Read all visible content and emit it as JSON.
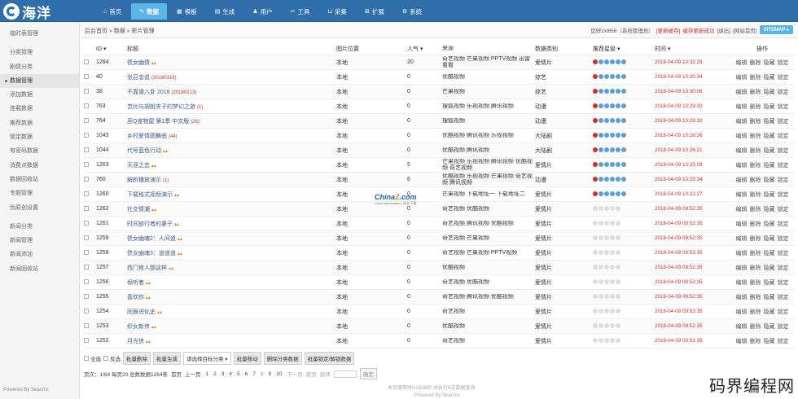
{
  "app": {
    "logo_text": "海洋"
  },
  "nav": [
    {
      "label": "首页",
      "icon": "⌂"
    },
    {
      "label": "数据",
      "icon": "✎",
      "active": true
    },
    {
      "label": "模板",
      "icon": "▦"
    },
    {
      "label": "生成",
      "icon": "▤"
    },
    {
      "label": "用户",
      "icon": "♟"
    },
    {
      "label": "工具",
      "icon": "✂"
    },
    {
      "label": "采集",
      "icon": "⊔"
    },
    {
      "label": "扩展",
      "icon": "⊞"
    },
    {
      "label": "系统",
      "icon": "⚙"
    }
  ],
  "sidebar": {
    "items": [
      {
        "label": "临时表管理"
      },
      {
        "sep": true
      },
      {
        "label": "分类管理"
      },
      {
        "label": "剧情分类"
      },
      {
        "label": "数据管理",
        "active": true
      },
      {
        "label": "添加数据"
      },
      {
        "label": "连载数据"
      },
      {
        "label": "推荐数据"
      },
      {
        "label": "锁定数据"
      },
      {
        "label": "有密码数据"
      },
      {
        "label": "消费点数据"
      },
      {
        "label": "数据回收站"
      },
      {
        "label": "专题管理"
      },
      {
        "label": "伪原创设置"
      },
      {
        "sep": true
      },
      {
        "label": "新闻分类"
      },
      {
        "label": "新闻管理"
      },
      {
        "label": "新闻添加"
      },
      {
        "label": "新闻回收站"
      }
    ],
    "footer": "Powered By Seacms"
  },
  "breadcrumb": "后台首页 » 数据 » 影片管理",
  "userbar": {
    "greeting": "您好zxt856（系统管理员）",
    "update_cache": "[更新缓存]",
    "cache_msg": "缓存更新成功",
    "logout": "[退出]",
    "home": "[网站首页]",
    "sitemap": "SITEMAP ▸"
  },
  "table": {
    "headers": {
      "id": "ID ▾",
      "title": "标题",
      "pic": "图片位置",
      "hot": "人气 ▾",
      "src": "来源",
      "type": "数据类别",
      "star": "推荐星级 ▾",
      "time": "时间 ▾",
      "ops": "操作"
    },
    "rows": [
      {
        "id": "1264",
        "title": "债女幽情",
        "tag": "",
        "hot_icon": true,
        "pic": "本地",
        "hot": "20",
        "src": "奇艺视频 芒果视频 PPTV视频 迅雷看看",
        "type": "爱情片",
        "stars": "rated",
        "time": "2018-04-09 10:32:25"
      },
      {
        "id": "40",
        "title": "张召忠说",
        "tag": "(20180316)",
        "hot_icon": false,
        "pic": "本地",
        "hot": "0",
        "src": "优酷视频",
        "type": "综艺",
        "stars": "rated",
        "time": "2018-04-09 10:30:34"
      },
      {
        "id": "38",
        "title": "不靠谱八卦 2018",
        "tag": "(20180213)",
        "hot_icon": false,
        "pic": "本地",
        "hot": "0",
        "src": "芒果视频",
        "type": "综艺",
        "stars": "rated",
        "time": "2018-04-09 10:30:06"
      },
      {
        "id": "763",
        "title": "岂比与胡桃夹子的梦幻之旅",
        "tag": "(1)",
        "hot_icon": false,
        "pic": "本地",
        "hot": "0",
        "src": "搜狐视频 乐视视频 腾讯视频",
        "type": "动漫",
        "stars": "rated",
        "time": "2018-04-09 10:29:32"
      },
      {
        "id": "764",
        "title": "巫Q宠物屋 第1季 中文版",
        "tag": "(26)",
        "hot_icon": false,
        "pic": "本地",
        "hot": "0",
        "src": "搜狐视频",
        "type": "动漫",
        "stars": "rated",
        "time": "2018-04-09 10:29:10"
      },
      {
        "id": "1043",
        "title": "乡村爱情圆舞曲",
        "tag": "(44)",
        "hot_icon": false,
        "pic": "本地",
        "hot": "0",
        "src": "优酷视频 腾讯视频 乐视视频",
        "type": "大陆剧",
        "stars": "rated",
        "time": "2018-04-09 10:28:26"
      },
      {
        "id": "1044",
        "title": "代号蓝色行动",
        "tag": "",
        "hot_icon": true,
        "pic": "本地",
        "hot": "0",
        "src": "优酷视频 腾讯视频",
        "type": "大陆剧",
        "stars": "rated",
        "time": "2018-04-09 10:26:21"
      },
      {
        "id": "1263",
        "title": "天涯之恋",
        "tag": "",
        "hot_icon": true,
        "pic": "本地",
        "hot": "5",
        "src": "芒果视频 乐视视频 腾讯视频 优酷视频 奇艺视频",
        "type": "爱情片",
        "stars": "rated",
        "time": "2018-04-09 10:25:29"
      },
      {
        "id": "760",
        "title": "解析播放演示",
        "tag": "(1)",
        "hot_icon": false,
        "pic": "本地",
        "hot": "6",
        "src": "优酷视频 乐视视频 芒果视频 奇艺视频 腾讯视频",
        "type": "动漫",
        "stars": "rated",
        "time": "2018-04-09 10:23:34"
      },
      {
        "id": "1260",
        "title": "下载格式视频演示",
        "tag": "",
        "hot_icon": true,
        "pic": "本地",
        "hot": "0",
        "src": "芒果视频 下载地址一 下载地址二",
        "type": "爱情片",
        "stars": "rated",
        "time": "2018-04-09 10:22:27"
      },
      {
        "id": "1262",
        "title": "社交情潮",
        "tag": "",
        "hot_icon": true,
        "pic": "本地",
        "hot": "0",
        "src": "奇艺视频 优酷视频",
        "type": "爱情片",
        "stars": "none",
        "time": "2018-04-09 09:52:35"
      },
      {
        "id": "1261",
        "title": "时间旅行者的妻子",
        "tag": "",
        "hot_icon": true,
        "pic": "本地",
        "hot": "0",
        "src": "奇艺视频 腾讯视频 优酷视频",
        "type": "爱情片",
        "stars": "none",
        "time": "2018-04-09 09:52:35"
      },
      {
        "id": "1259",
        "title": "债女幽魂2：人间道",
        "tag": "",
        "hot_icon": true,
        "pic": "本地",
        "hot": "0",
        "src": "奇艺视频 芒果视频",
        "type": "爱情片",
        "stars": "none",
        "time": "2018-04-09 09:52:35"
      },
      {
        "id": "1258",
        "title": "债女幽魂3：道道道",
        "tag": "",
        "hot_icon": true,
        "pic": "本地",
        "hot": "0",
        "src": "奇艺视频 芒果视频 PPTV视频",
        "type": "爱情片",
        "stars": "none",
        "time": "2018-04-09 09:52:35"
      },
      {
        "id": "1257",
        "title": "西门官人那这样",
        "tag": "",
        "hot_icon": true,
        "pic": "本地",
        "hot": "0",
        "src": "优酷视频",
        "type": "爱情片",
        "stars": "none",
        "time": "2018-04-09 09:52:35"
      },
      {
        "id": "1256",
        "title": "倾听者",
        "tag": "",
        "hot_icon": true,
        "pic": "本地",
        "hot": "0",
        "src": "奇艺视频 优酷视频",
        "type": "爱情片",
        "stars": "none",
        "time": "2018-04-09 09:52:35"
      },
      {
        "id": "1255",
        "title": "喜欢你",
        "tag": "",
        "hot_icon": true,
        "pic": "本地",
        "hot": "0",
        "src": "奇艺视频 腾讯视频 优酷视频",
        "type": "爱情片",
        "stars": "none",
        "time": "2018-04-09 09:52:35"
      },
      {
        "id": "1254",
        "title": "同居进化史",
        "tag": "",
        "hot_icon": true,
        "pic": "本地",
        "hot": "0",
        "src": "奇艺视频",
        "type": "爱情片",
        "stars": "none",
        "time": "2018-04-09 09:52:35"
      },
      {
        "id": "1253",
        "title": "织女新传",
        "tag": "",
        "hot_icon": true,
        "pic": "本地",
        "hot": "0",
        "src": "优酷视频",
        "type": "爱情片",
        "stars": "none",
        "time": "2018-04-09 09:52:35"
      },
      {
        "id": "1252",
        "title": "月光侠",
        "tag": "",
        "hot_icon": true,
        "pic": "本地",
        "hot": "0",
        "src": "奇艺视频",
        "type": "爱情片",
        "stars": "none",
        "time": "2018-04-09 09:52:35"
      }
    ],
    "ops": [
      "编辑",
      "删除",
      "隐藏",
      "锁定"
    ]
  },
  "watermark": {
    "title_a": "China",
    "title_b": "Z",
    "title_c": ".com",
    "sub": "China Webmaster | 站长下载"
  },
  "actions": {
    "select_all": "全选",
    "invert": "反选",
    "batch_delete": "批量删除",
    "batch_generate": "批量生成",
    "target_category": "请选择目标分类 ▾",
    "batch_move": "批量移动",
    "delete_category_data": "删除分类数据",
    "batch_lock": "批量锁定/解锁数据"
  },
  "pager": {
    "info": "页次：1/64 每页20 总数数据1264条",
    "first": "首页",
    "prev": "上一页",
    "pages": [
      "1",
      "2",
      "3",
      "4",
      "5",
      "6",
      "7",
      "8",
      "9",
      "10"
    ],
    "current": "8",
    "next": "下一页",
    "last": "尾页",
    "jump_label": "跳转",
    "confirm": "确定"
  },
  "footer": {
    "line1": "本页面用时0.0636秒,共执行6次数据查询",
    "line2": "Powered By Seacms"
  },
  "brand": "码界编程网"
}
